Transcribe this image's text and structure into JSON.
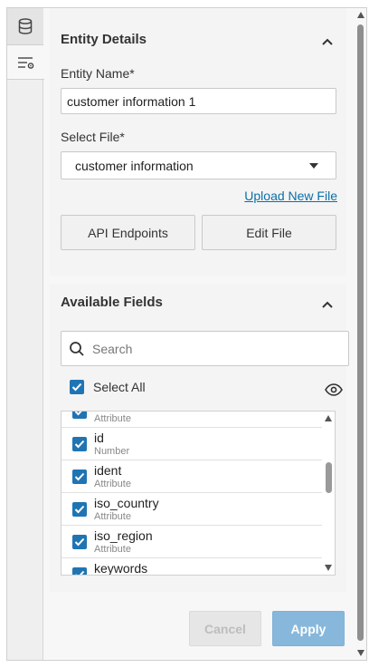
{
  "rail": {
    "tabs": [
      {
        "icon": "database-icon",
        "active": false
      },
      {
        "icon": "settings-list-icon",
        "active": true
      }
    ]
  },
  "details": {
    "title": "Entity Details",
    "entity_name_label": "Entity Name*",
    "entity_name_value": "customer information 1",
    "select_file_label": "Select File*",
    "select_file_value": "customer information",
    "upload_link": "Upload New File",
    "api_button": "API Endpoints",
    "edit_button": "Edit File"
  },
  "fields": {
    "title": "Available Fields",
    "search_placeholder": "Search",
    "select_all_label": "Select All",
    "rows": [
      {
        "name": "",
        "type": "Attribute"
      },
      {
        "name": "id",
        "type": "Number"
      },
      {
        "name": "ident",
        "type": "Attribute"
      },
      {
        "name": "iso_country",
        "type": "Attribute"
      },
      {
        "name": "iso_region",
        "type": "Attribute"
      },
      {
        "name": "keywords",
        "type": ""
      }
    ]
  },
  "footer": {
    "cancel_label": "Cancel",
    "apply_label": "Apply"
  },
  "colors": {
    "accent": "#1f75b3",
    "link": "#0a6fa8",
    "apply_bg": "#87b8db"
  }
}
